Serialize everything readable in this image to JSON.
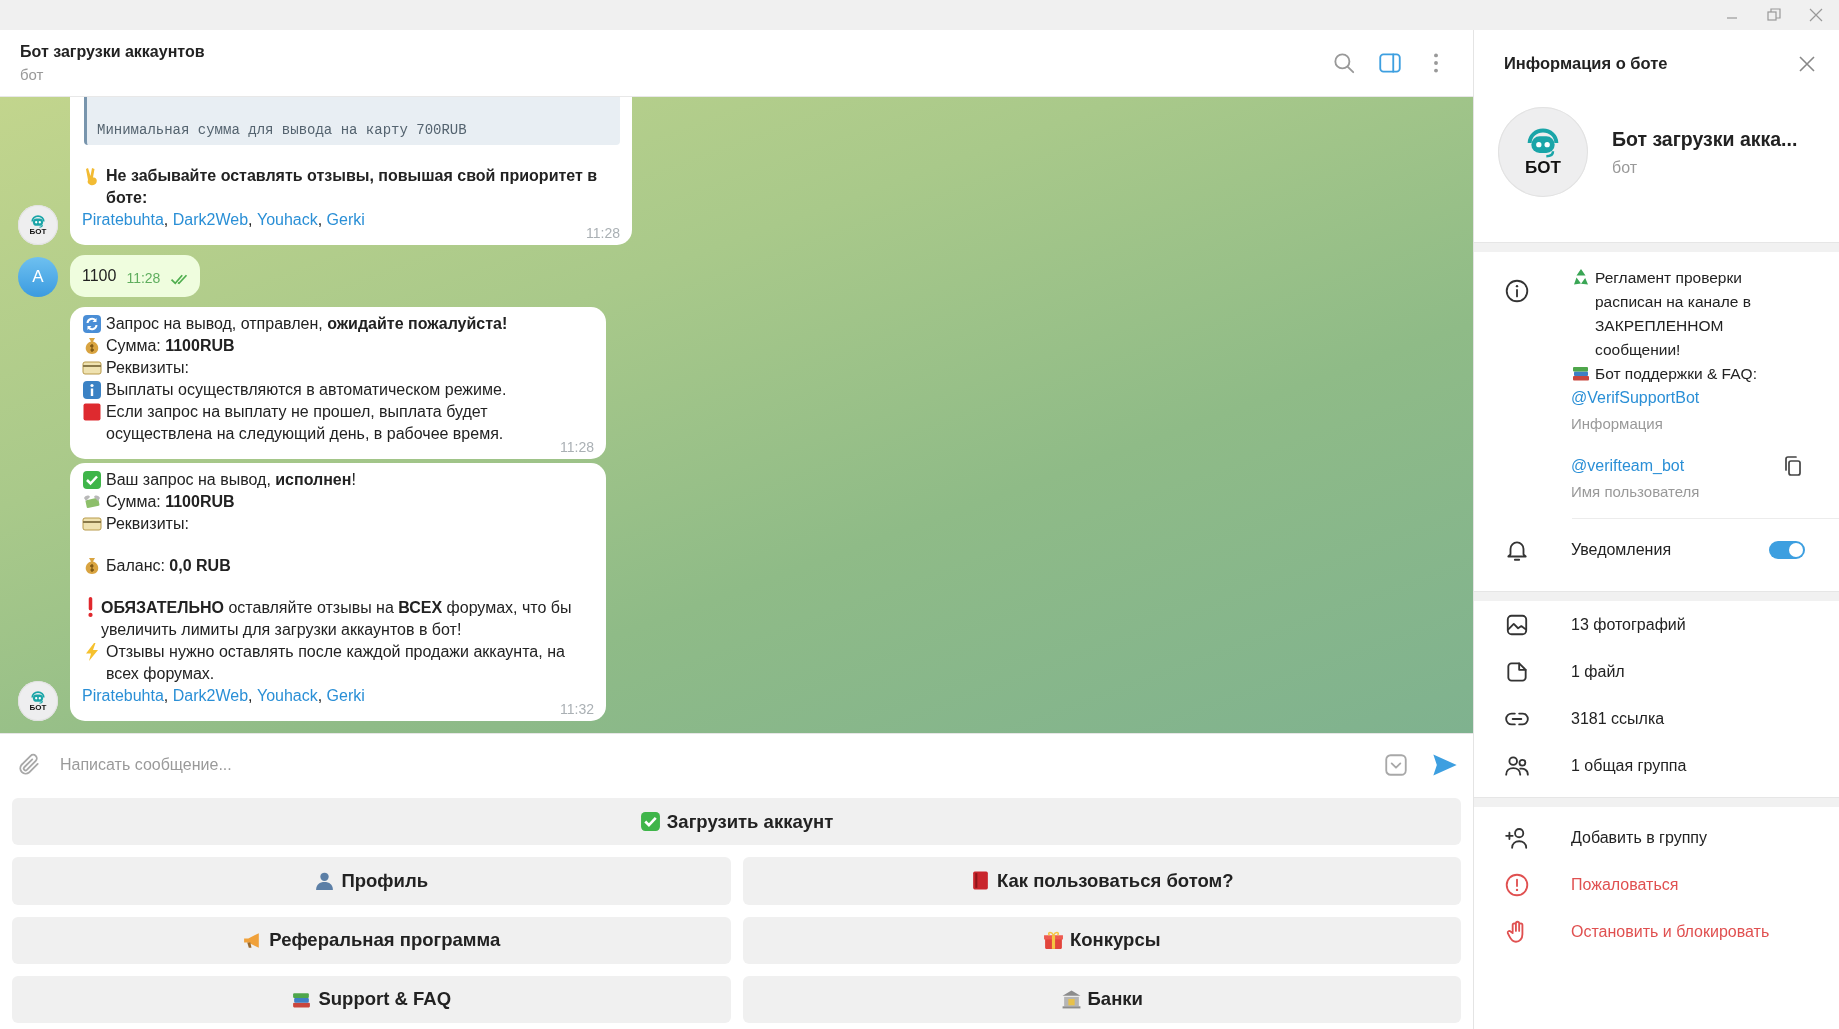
{
  "header": {
    "title": "Бот загрузки аккаунтов",
    "subtitle": "бот",
    "side_panel_open": true
  },
  "messages": [
    {
      "kind": "incoming",
      "time": "11:28",
      "avatar": {
        "kind": "bot",
        "label": "БОТ"
      },
      "lines": [
        {
          "kind": "quote",
          "text": "Минимальная сумма для вывода на карту 700RUB"
        },
        {
          "kind": "text",
          "icon": {
            "kind": "victory"
          },
          "bold": true,
          "gap_before": true,
          "text": "Не забывайте оставлять отзывы, повышая свой приоритет в боте:"
        },
        {
          "kind": "links",
          "separator": ", ",
          "items": [
            "Piratebuhta",
            "Dark2Web",
            "Youhack",
            "Gerki"
          ]
        }
      ]
    },
    {
      "kind": "outgoing",
      "text": "1100",
      "time": "11:28",
      "read": true,
      "avatar": {
        "kind": "letter",
        "label": "A"
      }
    },
    {
      "kind": "incoming",
      "time": "11:28",
      "lines": [
        {
          "kind": "text",
          "icon": {
            "kind": "refresh"
          },
          "text": "Запрос на вывод,  отправлен, **ожидайте пожалуйста!**"
        },
        {
          "kind": "text",
          "icon": {
            "kind": "moneybag"
          },
          "text": "Сумма: **1100RUB**"
        },
        {
          "kind": "text",
          "icon": {
            "kind": "card"
          },
          "text": "Реквизиты:"
        },
        {
          "kind": "text",
          "icon": {
            "kind": "info"
          },
          "text": "Выплаты осуществляются в автоматическом режиме."
        },
        {
          "kind": "text",
          "icon": {
            "kind": "redsquare"
          },
          "text": "Если запрос на выплату не прошел, выплата будет осуществлена на следующий день, в рабочее время."
        }
      ]
    },
    {
      "kind": "incoming",
      "time": "11:32",
      "avatar": {
        "kind": "bot",
        "label": "БОТ"
      },
      "lines": [
        {
          "kind": "text",
          "icon": {
            "kind": "check"
          },
          "text": "Ваш запрос на вывод, **исполнен**!"
        },
        {
          "kind": "text",
          "icon": {
            "kind": "moneywings"
          },
          "text": "Сумма: **1100RUB**"
        },
        {
          "kind": "text",
          "icon": {
            "kind": "card"
          },
          "text": "Реквизиты:"
        },
        {
          "kind": "text",
          "icon": {
            "kind": "moneybag"
          },
          "gap_before": true,
          "text": "Баланс: **0,0 RUB**"
        },
        {
          "kind": "text",
          "icon": {
            "kind": "exclamation"
          },
          "gap_before": true,
          "text": "**ОБЯЗАТЕЛЬНО** оставляйте отзывы на **ВСЕХ** форумах, что бы увеличить лимиты для загрузки аккаунтов в бот!"
        },
        {
          "kind": "text",
          "icon": {
            "kind": "lightning"
          },
          "text": "Отзывы нужно оставлять после каждой продажи аккаунта, на всех форумах."
        },
        {
          "kind": "links",
          "separator": ", ",
          "items": [
            "Piratebuhta",
            "Dark2Web",
            "Youhack",
            "Gerki"
          ]
        }
      ]
    }
  ],
  "composer": {
    "placeholder": "Написать сообщение..."
  },
  "keyboard": [
    [
      {
        "icon": {
          "kind": "check"
        },
        "label": "Загрузить аккаунт"
      }
    ],
    [
      {
        "icon": {
          "kind": "person"
        },
        "label": "Профиль"
      },
      {
        "icon": {
          "kind": "redbook"
        },
        "label": "Как пользоваться ботом?"
      }
    ],
    [
      {
        "icon": {
          "kind": "megaphone"
        },
        "label": "Реферальная программа"
      },
      {
        "icon": {
          "kind": "gift"
        },
        "label": "Конкурсы"
      }
    ],
    [
      {
        "icon": {
          "kind": "books"
        },
        "label": "Support & FAQ"
      },
      {
        "icon": {
          "kind": "bank"
        },
        "label": "Банки"
      }
    ]
  ],
  "info_panel": {
    "title": "Информация о боте",
    "profile": {
      "avatar_label": "БОТ",
      "name": "Бот загрузки акка...",
      "subtitle": "бот"
    },
    "about": {
      "lines": [
        {
          "icon": {
            "kind": "recycle"
          },
          "text": "Регламент проверки расписан на канале в ЗАКРЕПЛЕННОМ сообщении!"
        },
        {
          "icon": {
            "kind": "books"
          },
          "text": "Бот поддержки & FAQ:"
        }
      ],
      "link": "@VerifSupportBot",
      "caption": "Информация"
    },
    "username": {
      "value": "@verifteam_bot",
      "caption": "Имя пользователя"
    },
    "notifications": {
      "label": "Уведомления",
      "on": true
    },
    "media": [
      {
        "kind": "photos",
        "label": "13 фотографий"
      },
      {
        "kind": "files",
        "label": "1 файл"
      },
      {
        "kind": "links",
        "label": "3181 ссылка"
      },
      {
        "kind": "groups",
        "label": "1 общая группа"
      }
    ],
    "actions": [
      {
        "kind": "add",
        "label": "Добавить в группу",
        "danger": false
      },
      {
        "kind": "report",
        "label": "Пожаловаться",
        "danger": true
      },
      {
        "kind": "block",
        "label": "Остановить и блокировать",
        "danger": true
      }
    ]
  }
}
